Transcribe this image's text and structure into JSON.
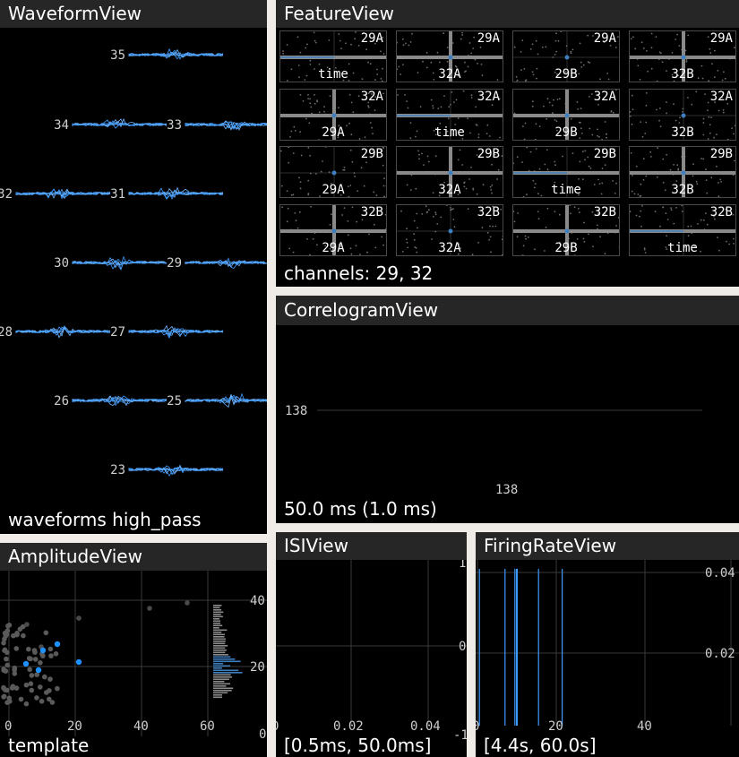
{
  "colors": {
    "background": "#000000",
    "title_bar": "#262626",
    "frame": "#efebe6",
    "waveform": "#3e9bff",
    "spike_blue": "#1e90ff",
    "point_gray": "#8a8a8a",
    "grid": "#3a3a3a"
  },
  "waveform_view": {
    "title": "WaveformView",
    "status": "waveforms high_pass",
    "channels": [
      {
        "label": "35"
      },
      {
        "label": "34"
      },
      {
        "label": "33"
      },
      {
        "label": "32"
      },
      {
        "label": "31"
      },
      {
        "label": "30"
      },
      {
        "label": "29"
      },
      {
        "label": "28"
      },
      {
        "label": "27"
      },
      {
        "label": "26"
      },
      {
        "label": "25"
      },
      {
        "label": "23"
      }
    ]
  },
  "feature_view": {
    "title": "FeatureView",
    "status": "channels: 29, 32",
    "grid": [
      [
        {
          "corner": "29A",
          "bottom": "time",
          "kind": "time"
        },
        {
          "corner": "29A",
          "bottom": "32A",
          "kind": "cross"
        },
        {
          "corner": "29A",
          "bottom": "29B",
          "kind": "dot"
        },
        {
          "corner": "29A",
          "bottom": "32B",
          "kind": "cross"
        }
      ],
      [
        {
          "corner": "32A",
          "bottom": "29A",
          "kind": "cross"
        },
        {
          "corner": "32A",
          "bottom": "time",
          "kind": "time"
        },
        {
          "corner": "32A",
          "bottom": "29B",
          "kind": "cross"
        },
        {
          "corner": "32A",
          "bottom": "32B",
          "kind": "dot"
        }
      ],
      [
        {
          "corner": "29B",
          "bottom": "29A",
          "kind": "dot"
        },
        {
          "corner": "29B",
          "bottom": "32A",
          "kind": "cross"
        },
        {
          "corner": "29B",
          "bottom": "time",
          "kind": "time"
        },
        {
          "corner": "29B",
          "bottom": "32B",
          "kind": "cross"
        }
      ],
      [
        {
          "corner": "32B",
          "bottom": "29A",
          "kind": "cross"
        },
        {
          "corner": "32B",
          "bottom": "32A",
          "kind": "dot"
        },
        {
          "corner": "32B",
          "bottom": "29B",
          "kind": "cross"
        },
        {
          "corner": "32B",
          "bottom": "time",
          "kind": "time"
        }
      ]
    ]
  },
  "correlogram_view": {
    "title": "CorrelogramView",
    "status": "50.0 ms (1.0 ms)",
    "y_label": "138",
    "x_label": "138"
  },
  "amplitude_view": {
    "title": "AmplitudeView",
    "status": "template",
    "x_ticks": [
      "0",
      "20",
      "40",
      "60"
    ],
    "y_ticks": [
      "40",
      "20",
      "0"
    ]
  },
  "isi_view": {
    "title": "ISIView",
    "status": "[0.5ms, 50.0ms]",
    "x_ticks": [
      "0",
      "0.02",
      "0.04"
    ],
    "y_ticks": [
      "1",
      "0",
      "-1"
    ]
  },
  "firing_rate_view": {
    "title": "FiringRateView",
    "status": "[4.4s, 60.0s]",
    "x_ticks": [
      "0",
      "20",
      "40"
    ],
    "y_ticks": [
      "0.04",
      "0.02"
    ],
    "spikes_s": [
      0.5,
      7,
      9.5,
      10,
      15.5,
      21.5
    ]
  }
}
